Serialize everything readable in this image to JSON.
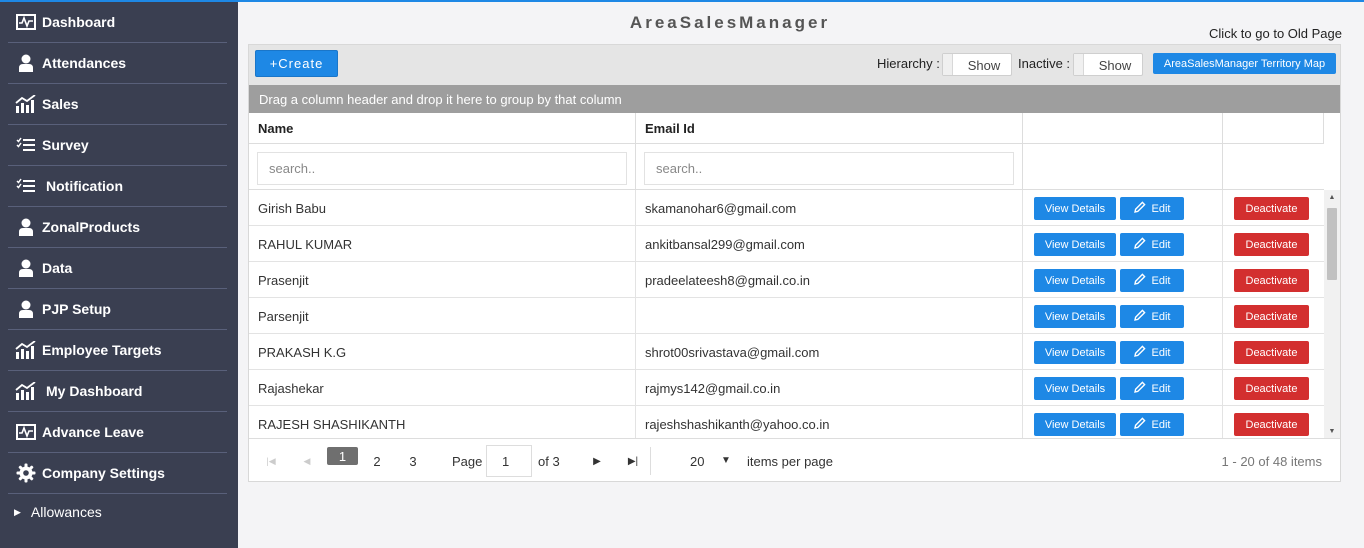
{
  "sidebar": {
    "items": [
      {
        "label": "Dashboard",
        "icon": "dashboard-icon"
      },
      {
        "label": "Attendances",
        "icon": "user-icon"
      },
      {
        "label": "Sales",
        "icon": "chart-icon"
      },
      {
        "label": "Survey",
        "icon": "checklist-icon"
      },
      {
        "label": "Notification",
        "icon": "checklist-icon"
      },
      {
        "label": "ZonalProducts",
        "icon": "user-icon"
      },
      {
        "label": "Data",
        "icon": "user-icon"
      },
      {
        "label": "PJP Setup",
        "icon": "user-icon"
      },
      {
        "label": "Employee Targets",
        "icon": "chart-icon"
      },
      {
        "label": "My Dashboard",
        "icon": "chart-icon"
      },
      {
        "label": "Advance Leave",
        "icon": "dashboard-icon"
      },
      {
        "label": "Company Settings",
        "icon": "gear-icon"
      }
    ],
    "sub": {
      "label": "Allowances",
      "icon": "caret-right-icon"
    }
  },
  "header": {
    "title": "AreaSalesManager",
    "old_page_link": "Click to go to Old Page"
  },
  "toolbar": {
    "create_label": "+Create",
    "hierarchy_label": "Hierarchy :",
    "hierarchy_toggle": "Show",
    "inactive_label": "Inactive :",
    "inactive_toggle": "Show",
    "territory_map_label": "AreaSalesManager Territory Map"
  },
  "group_bar": "Drag a column header and drop it here to group by that column",
  "columns": {
    "name": "Name",
    "email": "Email Id"
  },
  "filters": {
    "name_placeholder": "search..",
    "email_placeholder": "search.."
  },
  "row_actions": {
    "view": "View Details",
    "edit": "Edit",
    "deactivate": "Deactivate"
  },
  "rows": [
    {
      "name": "Girish Babu",
      "email": "skamanohar6@gmail.com"
    },
    {
      "name": "RAHUL KUMAR",
      "email": "ankitbansal299@gmail.com"
    },
    {
      "name": "Prasenjit",
      "email": "pradeelateesh8@gmail.co.in"
    },
    {
      "name": "Parsenjit",
      "email": ""
    },
    {
      "name": "PRAKASH K.G",
      "email": "shrot00srivastava@gmail.com"
    },
    {
      "name": "Rajashekar",
      "email": "rajmys142@gmail.co.in"
    },
    {
      "name": "RAJESH SHASHIKANTH",
      "email": "rajeshshashikanth@yahoo.co.in"
    }
  ],
  "pager": {
    "pages": [
      "1",
      "2",
      "3"
    ],
    "current_page": "1",
    "page_label": "Page",
    "page_value": "1",
    "of_label": "of 3",
    "page_size": "20",
    "items_per_page_label": "items per page",
    "info": "1 - 20 of 48 items"
  },
  "colors": {
    "primary": "#1e88e5",
    "danger": "#d32f2f",
    "sidebar": "#3a3f51"
  }
}
